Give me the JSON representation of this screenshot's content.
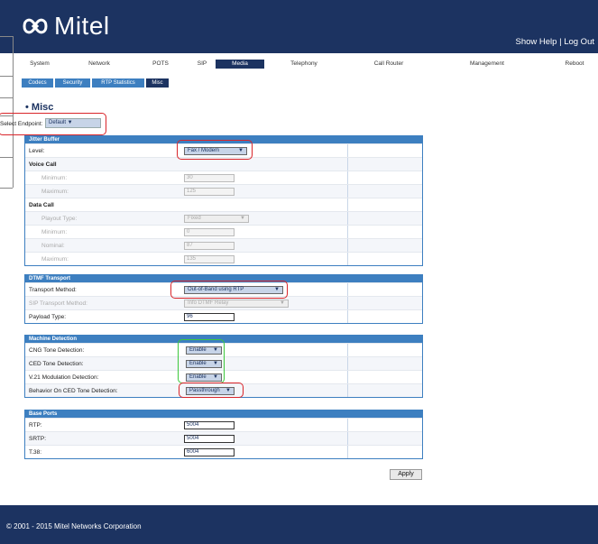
{
  "header": {
    "logo_text": "Mitel",
    "show_help": "Show Help",
    "separator": "|",
    "log_out": "Log Out"
  },
  "nav": {
    "items": [
      "System",
      "Network",
      "POTS",
      "SIP",
      "Media",
      "Telephony",
      "Call Router",
      "Management",
      "Reboot"
    ],
    "active": "Media"
  },
  "subtabs": {
    "items": [
      "Codecs",
      "Security",
      "RTP Statistics",
      "Misc"
    ],
    "active": "Misc"
  },
  "page": {
    "title": "• Misc",
    "endpoint_label": "Select Endpoint:",
    "endpoint_value": "Default"
  },
  "jitter": {
    "header": "Jitter Buffer",
    "level_label": "Level:",
    "level_value": "Fax / Modem",
    "voice_call": "Voice Call",
    "vc_min_label": "Minimum:",
    "vc_min": "30",
    "vc_max_label": "Maximum:",
    "vc_max": "125",
    "data_call": "Data Call",
    "playout_label": "Playout Type:",
    "playout_value": "Fixed",
    "dc_min_label": "Minimum:",
    "dc_min": "0",
    "dc_nom_label": "Nominal:",
    "dc_nom": "87",
    "dc_max_label": "Maximum:",
    "dc_max": "135"
  },
  "dtmf": {
    "header": "DTMF Transport",
    "method_label": "Transport Method:",
    "method_value": "Out-of-Band using RTP",
    "sip_label": "SIP Transport Method:",
    "sip_value": "Info DTMF Relay",
    "payload_label": "Payload Type:",
    "payload_value": "96"
  },
  "machine": {
    "header": "Machine Detection",
    "cng_label": "CNG Tone Detection:",
    "cng_value": "Enable",
    "ced_label": "CED Tone Detection:",
    "ced_value": "Enable",
    "v21_label": "V.21 Modulation Detection:",
    "v21_value": "Enable",
    "behavior_label": "Behavior On CED Tone Detection:",
    "behavior_value": "Passthrough"
  },
  "ports": {
    "header": "Base Ports",
    "rtp_label": "RTP:",
    "rtp_value": "5004",
    "srtp_label": "SRTP:",
    "srtp_value": "5004",
    "t38_label": "T.38:",
    "t38_value": "6004"
  },
  "apply_label": "Apply",
  "footer": {
    "copyright": "© 2001 - 2015 Mitel Networks Corporation"
  },
  "colors": {
    "navy": "#1c3361",
    "blue": "#3d7fc0",
    "highlight_red": "#d9252a",
    "highlight_green": "#3cc83c"
  }
}
